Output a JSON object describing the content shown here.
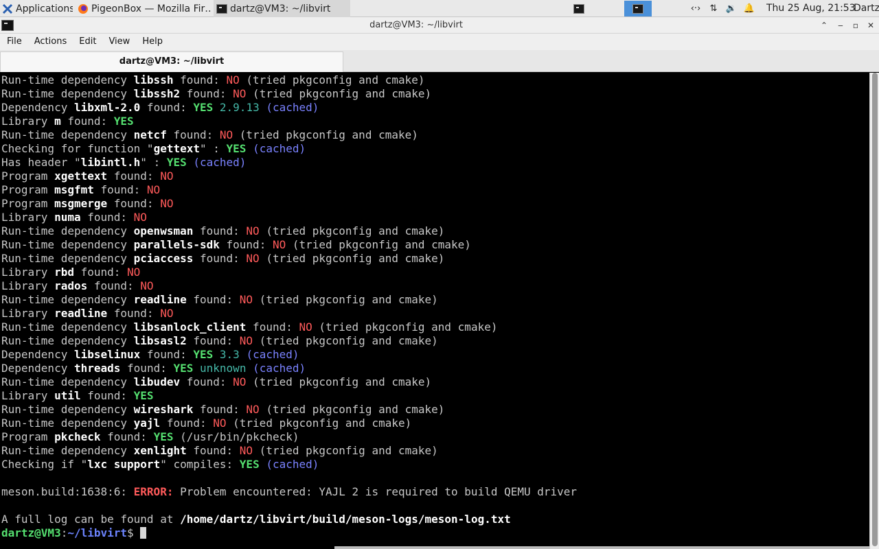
{
  "taskbar": {
    "applications_label": "Applications",
    "firefox_label": "PigeonBox — Mozilla Fir…",
    "terminal_label": "dartz@VM3: ~/libvirt",
    "clock": "Thu 25 Aug, 21:53",
    "user": "Dartz",
    "tray_icons": [
      "network-arrows-icon",
      "transfer-icon",
      "volume-icon",
      "bell-icon"
    ]
  },
  "window": {
    "title": "dartz@VM3: ~/libvirt"
  },
  "menubar": {
    "file": "File",
    "actions": "Actions",
    "edit": "Edit",
    "view": "View",
    "help": "Help"
  },
  "tab": {
    "label": "dartz@VM3: ~/libvirt"
  },
  "terminal": {
    "colors": {
      "yes": "#55e070",
      "no": "#ff5a5a",
      "cached": "#7a82ff",
      "version": "#45b8a8",
      "bold": "#ffffff"
    },
    "lines": [
      [
        [
          "t",
          "Run-time dependency "
        ],
        [
          "b",
          "libssh"
        ],
        [
          "t",
          " found: "
        ],
        [
          "no",
          "NO"
        ],
        [
          "t",
          " (tried pkgconfig and cmake)"
        ]
      ],
      [
        [
          "t",
          "Run-time dependency "
        ],
        [
          "b",
          "libssh2"
        ],
        [
          "t",
          " found: "
        ],
        [
          "no",
          "NO"
        ],
        [
          "t",
          " (tried pkgconfig and cmake)"
        ]
      ],
      [
        [
          "t",
          "Dependency "
        ],
        [
          "b",
          "libxml-2.0"
        ],
        [
          "t",
          " found: "
        ],
        [
          "yes",
          "YES"
        ],
        [
          "t",
          " "
        ],
        [
          "ver",
          "2.9.13"
        ],
        [
          "t",
          " "
        ],
        [
          "cached",
          "(cached)"
        ]
      ],
      [
        [
          "t",
          "Library "
        ],
        [
          "b",
          "m"
        ],
        [
          "t",
          " found: "
        ],
        [
          "yes",
          "YES"
        ]
      ],
      [
        [
          "t",
          "Run-time dependency "
        ],
        [
          "b",
          "netcf"
        ],
        [
          "t",
          " found: "
        ],
        [
          "no",
          "NO"
        ],
        [
          "t",
          " (tried pkgconfig and cmake)"
        ]
      ],
      [
        [
          "t",
          "Checking for function \""
        ],
        [
          "b",
          "gettext"
        ],
        [
          "t",
          "\" : "
        ],
        [
          "yes",
          "YES"
        ],
        [
          "t",
          " "
        ],
        [
          "cached",
          "(cached)"
        ]
      ],
      [
        [
          "t",
          "Has header \""
        ],
        [
          "b",
          "libintl.h"
        ],
        [
          "t",
          "\" : "
        ],
        [
          "yes",
          "YES"
        ],
        [
          "t",
          " "
        ],
        [
          "cached",
          "(cached)"
        ]
      ],
      [
        [
          "t",
          "Program "
        ],
        [
          "b",
          "xgettext"
        ],
        [
          "t",
          " found: "
        ],
        [
          "no",
          "NO"
        ]
      ],
      [
        [
          "t",
          "Program "
        ],
        [
          "b",
          "msgfmt"
        ],
        [
          "t",
          " found: "
        ],
        [
          "no",
          "NO"
        ]
      ],
      [
        [
          "t",
          "Program "
        ],
        [
          "b",
          "msgmerge"
        ],
        [
          "t",
          " found: "
        ],
        [
          "no",
          "NO"
        ]
      ],
      [
        [
          "t",
          "Library "
        ],
        [
          "b",
          "numa"
        ],
        [
          "t",
          " found: "
        ],
        [
          "no",
          "NO"
        ]
      ],
      [
        [
          "t",
          "Run-time dependency "
        ],
        [
          "b",
          "openwsman"
        ],
        [
          "t",
          " found: "
        ],
        [
          "no",
          "NO"
        ],
        [
          "t",
          " (tried pkgconfig and cmake)"
        ]
      ],
      [
        [
          "t",
          "Run-time dependency "
        ],
        [
          "b",
          "parallels-sdk"
        ],
        [
          "t",
          " found: "
        ],
        [
          "no",
          "NO"
        ],
        [
          "t",
          " (tried pkgconfig and cmake)"
        ]
      ],
      [
        [
          "t",
          "Run-time dependency "
        ],
        [
          "b",
          "pciaccess"
        ],
        [
          "t",
          " found: "
        ],
        [
          "no",
          "NO"
        ],
        [
          "t",
          " (tried pkgconfig and cmake)"
        ]
      ],
      [
        [
          "t",
          "Library "
        ],
        [
          "b",
          "rbd"
        ],
        [
          "t",
          " found: "
        ],
        [
          "no",
          "NO"
        ]
      ],
      [
        [
          "t",
          "Library "
        ],
        [
          "b",
          "rados"
        ],
        [
          "t",
          " found: "
        ],
        [
          "no",
          "NO"
        ]
      ],
      [
        [
          "t",
          "Run-time dependency "
        ],
        [
          "b",
          "readline"
        ],
        [
          "t",
          " found: "
        ],
        [
          "no",
          "NO"
        ],
        [
          "t",
          " (tried pkgconfig and cmake)"
        ]
      ],
      [
        [
          "t",
          "Library "
        ],
        [
          "b",
          "readline"
        ],
        [
          "t",
          " found: "
        ],
        [
          "no",
          "NO"
        ]
      ],
      [
        [
          "t",
          "Run-time dependency "
        ],
        [
          "b",
          "libsanlock_client"
        ],
        [
          "t",
          " found: "
        ],
        [
          "no",
          "NO"
        ],
        [
          "t",
          " (tried pkgconfig and cmake)"
        ]
      ],
      [
        [
          "t",
          "Run-time dependency "
        ],
        [
          "b",
          "libsasl2"
        ],
        [
          "t",
          " found: "
        ],
        [
          "no",
          "NO"
        ],
        [
          "t",
          " (tried pkgconfig and cmake)"
        ]
      ],
      [
        [
          "t",
          "Dependency "
        ],
        [
          "b",
          "libselinux"
        ],
        [
          "t",
          " found: "
        ],
        [
          "yes",
          "YES"
        ],
        [
          "t",
          " "
        ],
        [
          "ver",
          "3.3"
        ],
        [
          "t",
          " "
        ],
        [
          "cached",
          "(cached)"
        ]
      ],
      [
        [
          "t",
          "Dependency "
        ],
        [
          "b",
          "threads"
        ],
        [
          "t",
          " found: "
        ],
        [
          "yes",
          "YES"
        ],
        [
          "t",
          " "
        ],
        [
          "ver",
          "unknown"
        ],
        [
          "t",
          " "
        ],
        [
          "cached",
          "(cached)"
        ]
      ],
      [
        [
          "t",
          "Run-time dependency "
        ],
        [
          "b",
          "libudev"
        ],
        [
          "t",
          " found: "
        ],
        [
          "no",
          "NO"
        ],
        [
          "t",
          " (tried pkgconfig and cmake)"
        ]
      ],
      [
        [
          "t",
          "Library "
        ],
        [
          "b",
          "util"
        ],
        [
          "t",
          " found: "
        ],
        [
          "yes",
          "YES"
        ]
      ],
      [
        [
          "t",
          "Run-time dependency "
        ],
        [
          "b",
          "wireshark"
        ],
        [
          "t",
          " found: "
        ],
        [
          "no",
          "NO"
        ],
        [
          "t",
          " (tried pkgconfig and cmake)"
        ]
      ],
      [
        [
          "t",
          "Run-time dependency "
        ],
        [
          "b",
          "yajl"
        ],
        [
          "t",
          " found: "
        ],
        [
          "no",
          "NO"
        ],
        [
          "t",
          " (tried pkgconfig and cmake)"
        ]
      ],
      [
        [
          "t",
          "Program "
        ],
        [
          "b",
          "pkcheck"
        ],
        [
          "t",
          " found: "
        ],
        [
          "yes",
          "YES"
        ],
        [
          "t",
          " (/usr/bin/pkcheck)"
        ]
      ],
      [
        [
          "t",
          "Run-time dependency "
        ],
        [
          "b",
          "xenlight"
        ],
        [
          "t",
          " found: "
        ],
        [
          "no",
          "NO"
        ],
        [
          "t",
          " (tried pkgconfig and cmake)"
        ]
      ],
      [
        [
          "t",
          "Checking if \""
        ],
        [
          "b",
          "lxc support"
        ],
        [
          "t",
          "\" compiles: "
        ],
        [
          "yes",
          "YES"
        ],
        [
          "t",
          " "
        ],
        [
          "cached",
          "(cached)"
        ]
      ],
      [],
      [
        [
          "t",
          "meson.build:1638:6: "
        ],
        [
          "err",
          "ERROR:"
        ],
        [
          "t",
          " Problem encountered: YAJL 2 is required to build QEMU driver"
        ]
      ],
      [],
      [
        [
          "t",
          "A full log can be found at "
        ],
        [
          "b",
          "/home/dartz/libvirt/build/meson-logs/meson-log.txt"
        ]
      ]
    ],
    "prompt": {
      "user_host": "dartz@VM3",
      "separator": ":",
      "path": "~/libvirt",
      "symbol": "$ "
    }
  }
}
